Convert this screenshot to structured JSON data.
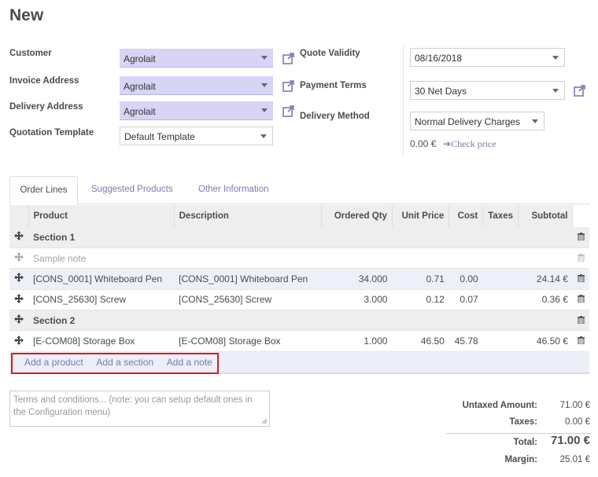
{
  "page": {
    "title": "New"
  },
  "form": {
    "customer_label": "Customer",
    "customer_value": "Agrolait",
    "invoice_label": "Invoice Address",
    "invoice_value": "Agrolait",
    "delivery_label": "Delivery Address",
    "delivery_value": "Agrolait",
    "template_label": "Quotation Template",
    "template_value": "Default Template",
    "validity_label": "Quote Validity",
    "validity_value": "08/16/2018",
    "terms_label": "Payment Terms",
    "terms_value": "30 Net Days",
    "method_label": "Delivery Method",
    "method_value": "Normal Delivery Charges",
    "delivery_price": "0.00 €",
    "check_price": "Check price"
  },
  "tabs": [
    {
      "label": "Order Lines"
    },
    {
      "label": "Suggested Products"
    },
    {
      "label": "Other Information"
    }
  ],
  "table": {
    "headers": [
      "Product",
      "Description",
      "Ordered Qty",
      "Unit Price",
      "Cost",
      "Taxes",
      "Subtotal"
    ],
    "rows": [
      {
        "product": "Section 1"
      },
      {
        "product": "Sample note"
      },
      {
        "product": "[CONS_0001] Whiteboard Pen",
        "description": "[CONS_0001] Whiteboard Pen",
        "qty": "34.000",
        "price": "0.71",
        "cost": "0.00",
        "subtotal": "24.14 €"
      },
      {
        "product": "[CONS_25630] Screw",
        "description": "[CONS_25630] Screw",
        "qty": "3.000",
        "price": "0.12",
        "cost": "0.07",
        "subtotal": "0.36 €"
      },
      {
        "product": "Section 2"
      },
      {
        "product": "[E-COM08] Storage Box",
        "description": "[E-COM08] Storage Box",
        "qty": "1.000",
        "price": "46.50",
        "cost": "45.78",
        "subtotal": "46.50 €"
      }
    ],
    "add_product": "Add a product",
    "add_section": "Add a section",
    "add_note": "Add a note"
  },
  "notes": {
    "placeholder": "Terms and conditions... (note: you can setup default ones in the Configuration menu)"
  },
  "totals": {
    "untaxed_label": "Untaxed Amount:",
    "untaxed_value": "71.00 €",
    "taxes_label": "Taxes:",
    "taxes_value": "0.00 €",
    "total_label": "Total:",
    "total_value": "71.00 €",
    "margin_label": "Margin:",
    "margin_value": "25.01 €"
  },
  "colors": {
    "accent": "#7c7bad",
    "many2one_bg": "#d7d4f5",
    "highlight": "#e11a1a"
  },
  "icons": [
    "external-link-icon",
    "dropdown-caret-icon",
    "drag-handle-icon",
    "trash-icon",
    "arrow-right-icon",
    "resize-grip-icon"
  ]
}
